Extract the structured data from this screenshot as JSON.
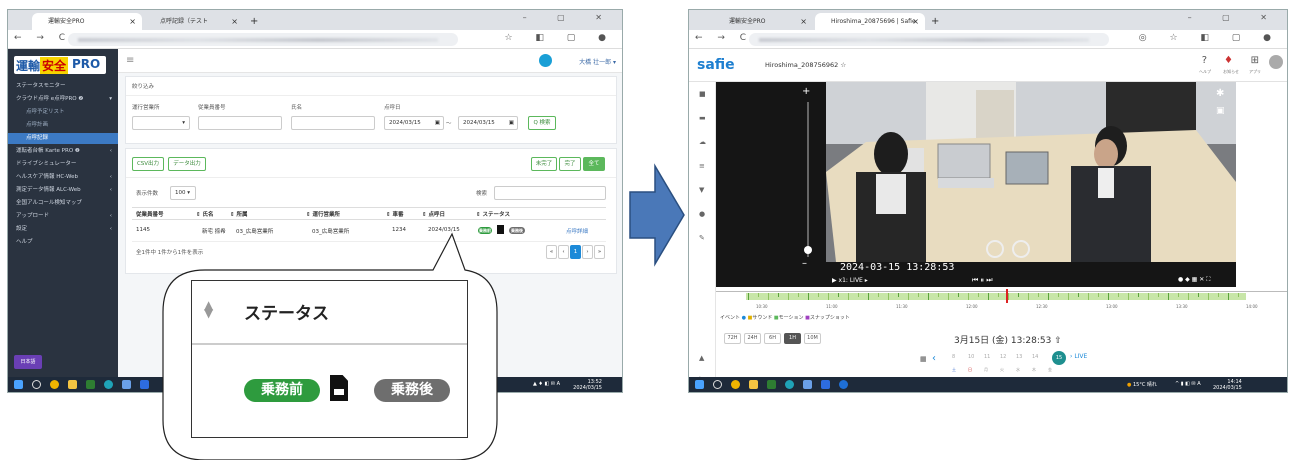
{
  "left_window": {
    "tabs": [
      {
        "title": "運輸安全PRO",
        "active": true
      },
      {
        "title": "点呼記録（テスト",
        "active": false
      }
    ],
    "app": {
      "logo": {
        "part1": "運輸",
        "part2": "安全",
        "part3": "PRO"
      },
      "user": "大橋 壮一郎 ▾",
      "sidebar": [
        {
          "label": "ステータスモニター",
          "level": 0
        },
        {
          "label": "クラウド点呼 e点呼PRO ❷",
          "level": 0,
          "caret": "▾"
        },
        {
          "label": "点呼予定リスト",
          "level": 1
        },
        {
          "label": "点呼計画",
          "level": 1
        },
        {
          "label": "点呼記録",
          "level": 1,
          "active": true
        },
        {
          "label": "運転者台帳 Karte PRO ❷",
          "level": 0,
          "caret": "‹"
        },
        {
          "label": "ドライブシミュレーター",
          "level": 0
        },
        {
          "label": "ヘルスケア情報 HC-Web",
          "level": 0,
          "caret": "‹"
        },
        {
          "label": "測定データ情報 ALC-Web",
          "level": 0,
          "caret": "‹"
        },
        {
          "label": "全国アルコール検知マップ",
          "level": 0
        },
        {
          "label": "アップロード",
          "level": 0,
          "caret": "‹"
        },
        {
          "label": "設定",
          "level": 0,
          "caret": "‹"
        },
        {
          "label": "ヘルプ",
          "level": 0
        }
      ],
      "lang_button": "日本語",
      "filter": {
        "title": "絞り込み",
        "office_label": "運行営業所",
        "employee_no_label": "従業員番号",
        "name_label": "氏名",
        "date_label": "点呼日",
        "date_from": "2024/03/15",
        "date_to": "2024/03/15",
        "date_sep": "〜",
        "search_button": "Q 検索"
      },
      "export": {
        "csv": "CSV出力",
        "data": "データ出力"
      },
      "status_filter": [
        "未完了",
        "完了",
        "全て"
      ],
      "page_size_label": "表示件数",
      "page_size": "100",
      "search_label": "検索",
      "table": {
        "columns": [
          "従業員番号",
          "氏名",
          "所属",
          "運行営業所",
          "車番",
          "点呼日",
          "ステータス"
        ],
        "rows": [
          {
            "employee_no": "1145",
            "name": "新宅 捺希",
            "dept": "03_広島営業所",
            "office": "03_広島営業所",
            "car": "1234",
            "date": "2024/03/15",
            "detail": "点呼詳細"
          }
        ]
      },
      "count_text": "全1件中 1件から1件を表示",
      "pagination": [
        "«",
        "‹",
        "1",
        "›",
        "»"
      ]
    }
  },
  "callout": {
    "header": "ステータス",
    "badge_before": "乗務前",
    "badge_after": "乗務後",
    "colors": {
      "before": "#2e9b3e",
      "after": "#6e6e6e"
    }
  },
  "right_window": {
    "tabs": [
      {
        "title": "運輸安全PRO",
        "active": false
      },
      {
        "title": "Hiroshima_20875696 | Safie",
        "active": true
      }
    ],
    "app": {
      "logo": "safie",
      "camera_name": "Hiroshima_208756962 ☆",
      "header_icons": [
        "ヘルプ",
        "お知らせ",
        "アプリ"
      ],
      "timestamp": "2024-03-15 13:28:53",
      "live_label": "x1: LIVE ▸",
      "event_legend": [
        "イベント",
        "サウンド",
        "モーション",
        "スナップショット"
      ],
      "time_display": "3月15日 (金) 13:28:53",
      "range_buttons": [
        "72H",
        "24H",
        "6H",
        "1H",
        "10M"
      ],
      "active_range": "1H",
      "tl_times": [
        "10:30",
        "11:00",
        "11:30",
        "12:00",
        "12:30",
        "13:00",
        "13:30",
        "14:00"
      ],
      "date_nav": [
        "8",
        "10",
        "11",
        "12",
        "13",
        "14",
        "15"
      ],
      "day_letters": [
        "土",
        "日",
        "月",
        "火",
        "水",
        "木",
        "金"
      ],
      "live_button": "LIVE"
    }
  },
  "taskbar_left": {
    "time": "13:52",
    "date": "2024/03/15"
  },
  "taskbar_right": {
    "weather": "15°C 晴れ",
    "time": "14:14",
    "date": "2024/03/15"
  }
}
